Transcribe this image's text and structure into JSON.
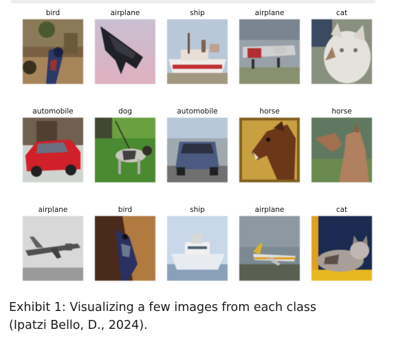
{
  "grid": {
    "rows": [
      {
        "cells": [
          {
            "label": "bird",
            "image": "bird-photo"
          },
          {
            "label": "airplane",
            "image": "stealth-bomber-photo"
          },
          {
            "label": "ship",
            "image": "ship-photo"
          },
          {
            "label": "airplane",
            "image": "airplane-photo"
          },
          {
            "label": "cat",
            "image": "white-cat-photo"
          }
        ]
      },
      {
        "cells": [
          {
            "label": "automobile",
            "image": "red-car-photo"
          },
          {
            "label": "dog",
            "image": "dog-on-grass-photo"
          },
          {
            "label": "automobile",
            "image": "blue-car-photo"
          },
          {
            "label": "horse",
            "image": "brown-horse-photo"
          },
          {
            "label": "horse",
            "image": "horse-photo"
          }
        ]
      },
      {
        "cells": [
          {
            "label": "airplane",
            "image": "grey-airplane-photo"
          },
          {
            "label": "bird",
            "image": "bird-closeup-photo"
          },
          {
            "label": "ship",
            "image": "white-ship-photo"
          },
          {
            "label": "airplane",
            "image": "jet-on-runway-photo"
          },
          {
            "label": "cat",
            "image": "cat-on-yellow-photo"
          }
        ]
      }
    ]
  },
  "caption": {
    "line1": "Exhibit 1: Visualizing a few images from each class",
    "line2": "(Ipatzi Bello, D., 2024)."
  }
}
